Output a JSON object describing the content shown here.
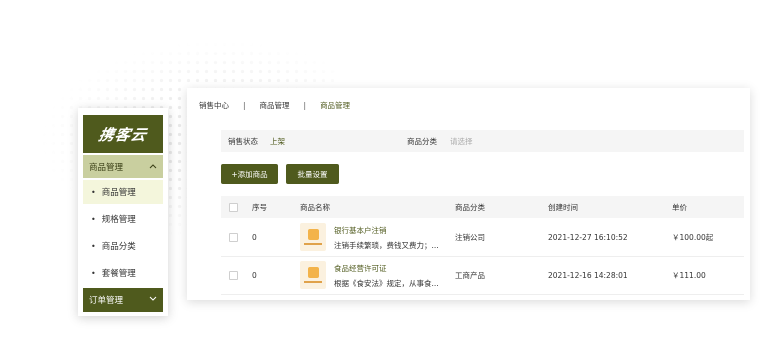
{
  "sidebar": {
    "logo_text": "携客云",
    "group_label": "商品管理",
    "items": [
      {
        "label": "商品管理"
      },
      {
        "label": "规格管理"
      },
      {
        "label": "商品分类"
      },
      {
        "label": "套餐管理"
      }
    ],
    "group2_label": "订单管理",
    "accent": "#4f5a1d"
  },
  "breadcrumb": {
    "items": [
      "销售中心",
      "商品管理",
      "商品管理"
    ],
    "separator": "|"
  },
  "filter": {
    "status_label": "销售状态",
    "status_value": "上架",
    "category_label": "商品分类",
    "category_placeholder": "请选择"
  },
  "actions": {
    "add_label": "+添加商品",
    "batch_label": "批量设置"
  },
  "table": {
    "headers": {
      "seq": "序号",
      "name": "商品名称",
      "category": "商品分类",
      "created": "创建时间",
      "price": "单价"
    },
    "rows": [
      {
        "seq": "0",
        "name": "银行基本户注销",
        "desc": "注销手续繁琐，费钱又费力；...",
        "category": "注销公司",
        "created": "2021-12-27 16:10:52",
        "price": "￥100.00起"
      },
      {
        "seq": "0",
        "name": "食品经营许可证",
        "desc": "根据《食安法》规定，从事食...",
        "category": "工商产品",
        "created": "2021-12-16 14:28:01",
        "price": "￥111.00"
      }
    ]
  }
}
